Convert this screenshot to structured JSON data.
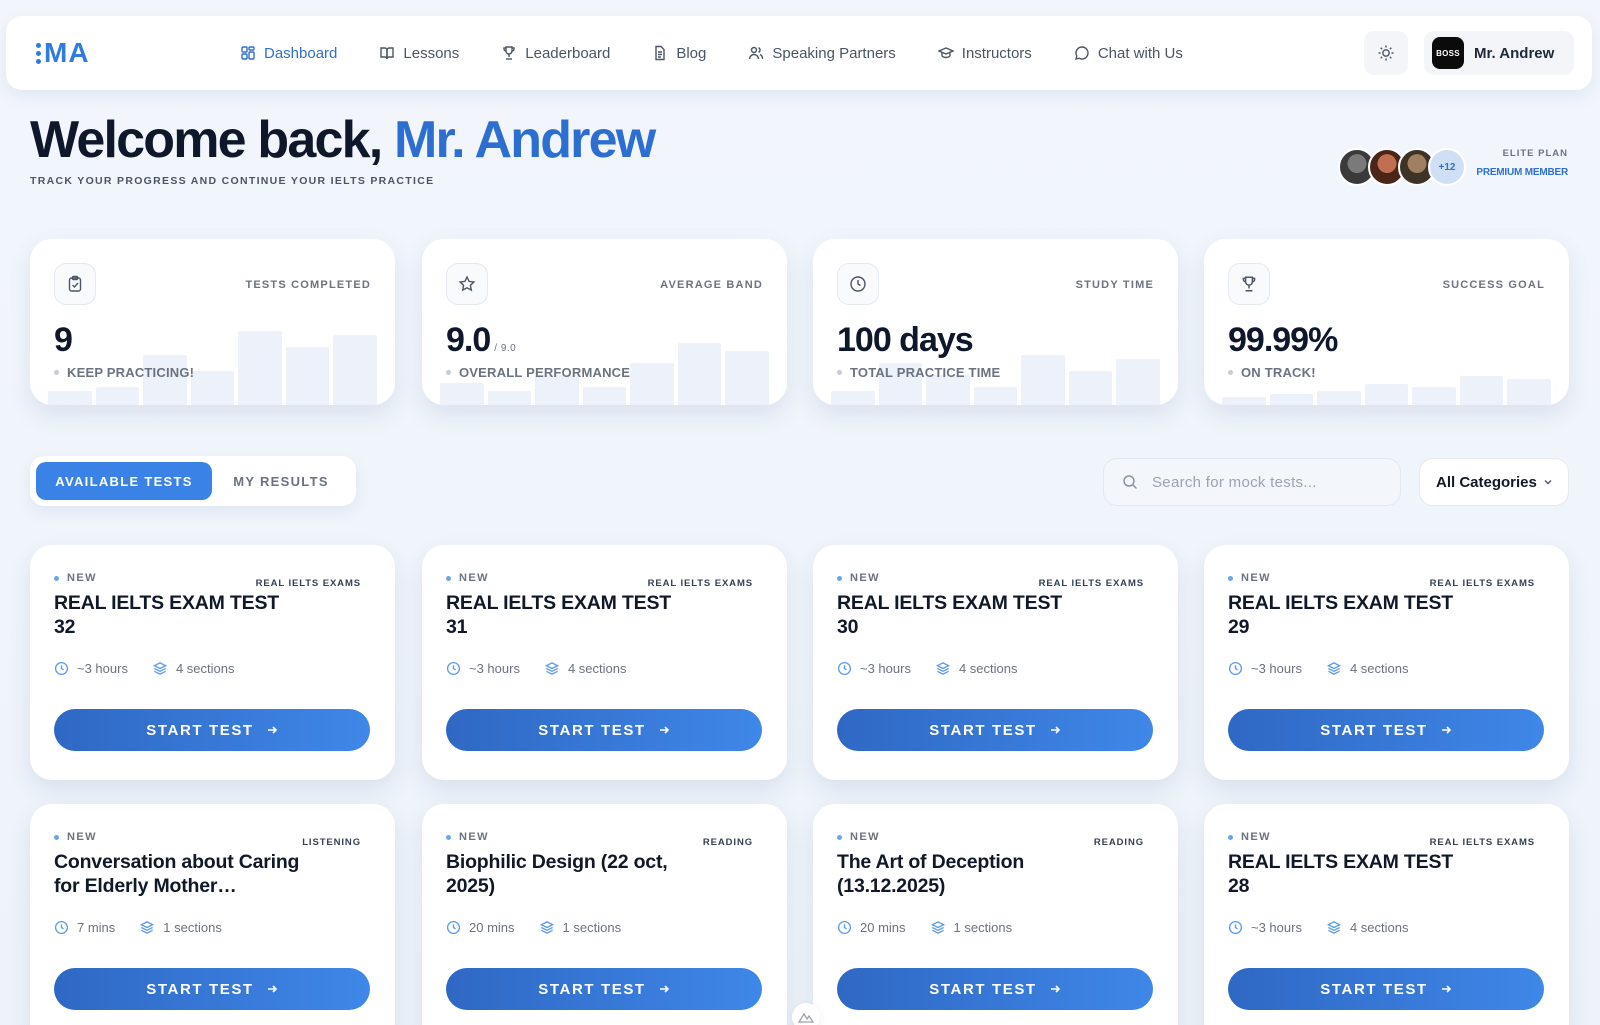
{
  "nav": {
    "logo_text": "M",
    "links": [
      {
        "label": "Dashboard",
        "icon": "dashboard-icon",
        "active": true
      },
      {
        "label": "Lessons",
        "icon": "book-icon",
        "active": false
      },
      {
        "label": "Leaderboard",
        "icon": "trophy-icon",
        "active": false
      },
      {
        "label": "Blog",
        "icon": "document-icon",
        "active": false
      },
      {
        "label": "Speaking Partners",
        "icon": "users-icon",
        "active": false
      },
      {
        "label": "Instructors",
        "icon": "graduation-cap-icon",
        "active": false
      },
      {
        "label": "Chat with Us",
        "icon": "chat-bubble-icon",
        "active": false
      }
    ],
    "user_badge": "BOSS",
    "user_name": "Mr. Andrew"
  },
  "header": {
    "welcome": "Welcome back,",
    "name": "Mr. Andrew",
    "subtitle": "TRACK YOUR PROGRESS AND CONTINUE YOUR IELTS PRACTICE",
    "extra_members": "+12",
    "plan_label": "ELITE PLAN",
    "plan_status": "PREMIUM MEMBER"
  },
  "stats": [
    {
      "label": "TESTS COMPLETED",
      "value": "9",
      "suffix": "",
      "note": "KEEP PRACTICING!",
      "icon": "clipboard-check-icon"
    },
    {
      "label": "AVERAGE BAND",
      "value": "9.0",
      "suffix": "/ 9.0",
      "note": "OVERALL PERFORMANCE",
      "icon": "star-icon"
    },
    {
      "label": "STUDY TIME",
      "value": "100 days",
      "suffix": "",
      "note": "TOTAL PRACTICE TIME",
      "icon": "clock-icon"
    },
    {
      "label": "SUCCESS GOAL",
      "value": "99.99%",
      "suffix": "",
      "note": "ON TRACK!",
      "icon": "trophy-icon"
    }
  ],
  "tabs": {
    "available": "AVAILABLE TESTS",
    "results": "MY RESULTS"
  },
  "search": {
    "placeholder": "Search for mock tests..."
  },
  "category_select": {
    "selected": "All Categories"
  },
  "tests": [
    {
      "badge": "NEW",
      "category": "REAL IELTS EXAMS",
      "title": "REAL IELTS EXAM TEST 32",
      "duration": "~3 hours",
      "sections": "4 sections",
      "button": "START TEST"
    },
    {
      "badge": "NEW",
      "category": "REAL IELTS EXAMS",
      "title": "REAL IELTS EXAM TEST 31",
      "duration": "~3 hours",
      "sections": "4 sections",
      "button": "START TEST"
    },
    {
      "badge": "NEW",
      "category": "REAL IELTS EXAMS",
      "title": "REAL IELTS EXAM TEST 30",
      "duration": "~3 hours",
      "sections": "4 sections",
      "button": "START TEST"
    },
    {
      "badge": "NEW",
      "category": "REAL IELTS EXAMS",
      "title": "REAL IELTS EXAM TEST 29",
      "duration": "~3 hours",
      "sections": "4 sections",
      "button": "START TEST"
    },
    {
      "badge": "NEW",
      "category": "LISTENING",
      "title": "Conversation about Caring for Elderly Mother…",
      "duration": "7 mins",
      "sections": "1 sections",
      "button": "START TEST"
    },
    {
      "badge": "NEW",
      "category": "READING",
      "title": "Biophilic Design (22 oct, 2025)",
      "duration": "20 mins",
      "sections": "1 sections",
      "button": "START TEST"
    },
    {
      "badge": "NEW",
      "category": "READING",
      "title": "The Art of Deception (13.12.2025)",
      "duration": "20 mins",
      "sections": "1 sections",
      "button": "START TEST"
    },
    {
      "badge": "NEW",
      "category": "REAL IELTS EXAMS",
      "title": "REAL IELTS EXAM TEST 28",
      "duration": "~3 hours",
      "sections": "4 sections",
      "button": "START TEST"
    }
  ]
}
